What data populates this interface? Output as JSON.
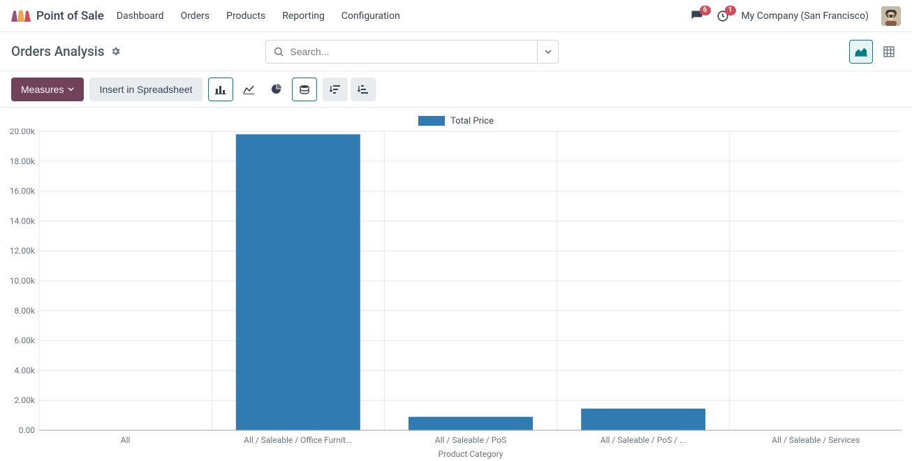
{
  "brand": {
    "title": "Point of Sale"
  },
  "nav": {
    "links": [
      "Dashboard",
      "Orders",
      "Products",
      "Reporting",
      "Configuration"
    ],
    "messages_badge": "6",
    "activities_badge": "1",
    "company": "My Company (San Francisco)"
  },
  "page": {
    "title": "Orders Analysis"
  },
  "search": {
    "placeholder": "Search..."
  },
  "toolbar": {
    "measures_label": "Measures",
    "insert_label": "Insert in Spreadsheet"
  },
  "legend": {
    "series": "Total Price"
  },
  "chart_data": {
    "type": "bar",
    "title": "",
    "xlabel": "Product Category",
    "ylabel": "",
    "ylim": [
      0,
      20000
    ],
    "yticks": [
      0,
      2000,
      4000,
      6000,
      8000,
      10000,
      12000,
      14000,
      16000,
      18000,
      20000
    ],
    "ytick_labels": [
      "0.00",
      "2.00k",
      "4.00k",
      "6.00k",
      "8.00k",
      "10.00k",
      "12.00k",
      "14.00k",
      "16.00k",
      "18.00k",
      "20.00k"
    ],
    "categories": [
      "All",
      "All / Saleable / Office Furnit...",
      "All / Saleable / PoS",
      "All / Saleable / PoS / ...",
      "All / Saleable / Services"
    ],
    "series": [
      {
        "name": "Total Price",
        "color": "#2f7bb2",
        "values": [
          0,
          19800,
          900,
          1450,
          0
        ]
      }
    ]
  }
}
